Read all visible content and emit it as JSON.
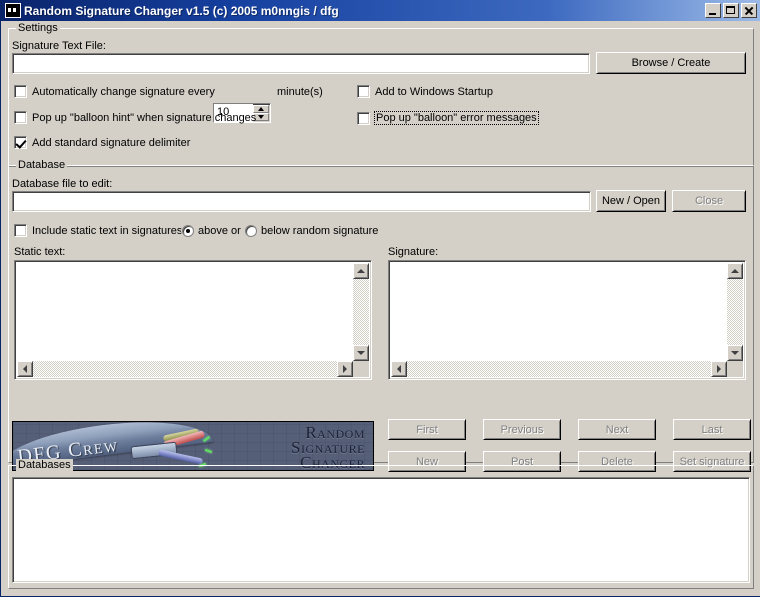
{
  "window": {
    "title": "Random Signature Changer v1.5 (c) 2005 m0nngis / dfg",
    "icon": "app-icon",
    "buttons": {
      "minimize": "minimize-button",
      "maximize": "maximize-button",
      "close": "close-button"
    }
  },
  "settings": {
    "group_title": "Settings",
    "sig_file_label": "Signature Text File:",
    "sig_file_value": "",
    "browse_button": "Browse / Create",
    "auto_change_label": "Automatically change signature every",
    "auto_change_checked": false,
    "interval_value": "10",
    "minutes_label": "minute(s)",
    "balloon_hint_label": "Pop up \"balloon hint\" when signature changes",
    "balloon_hint_checked": false,
    "delimiter_label": "Add standard signature delimiter",
    "delimiter_checked": true,
    "startup_label": "Add to Windows Startup",
    "startup_checked": false,
    "balloon_error_label": "Pop up \"balloon\" error messages",
    "balloon_error_checked": false
  },
  "database": {
    "group_title": "Database",
    "file_label": "Database file to edit:",
    "file_value": "",
    "new_open_button": "New / Open",
    "close_button": "Close",
    "include_static_label": "Include static text in signatures",
    "include_static_checked": false,
    "radio_above": "above or",
    "radio_below": "below random signature",
    "radio_selected": "above",
    "static_text_label": "Static text:",
    "static_text_value": "",
    "signature_label": "Signature:",
    "signature_value": ""
  },
  "logo": {
    "crew": "DFG Crew",
    "line1": "Random",
    "line2": "Signature",
    "line3": "Changer"
  },
  "nav_buttons": {
    "first": "First",
    "previous": "Previous",
    "next": "Next",
    "last": "Last",
    "new": "New",
    "post": "Post",
    "delete": "Delete",
    "set_signature": "Set signature"
  },
  "databases": {
    "group_title": "Databases",
    "items": []
  },
  "colors": {
    "face": "#d4d0c8",
    "title_start": "#0a246a",
    "title_end": "#9dbbe8",
    "disabled_text": "#808080"
  }
}
